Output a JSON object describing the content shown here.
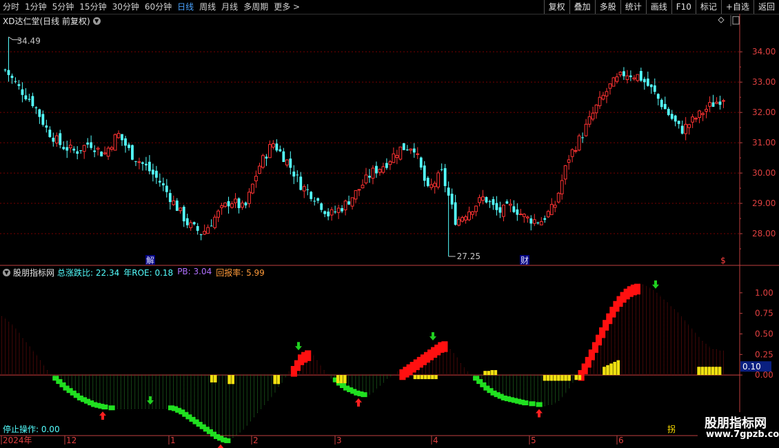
{
  "toolbar": {
    "period_tabs": [
      "分时",
      "1分钟",
      "5分钟",
      "15分钟",
      "30分钟",
      "60分钟",
      "日线",
      "周线",
      "月线",
      "多周期",
      "更多 >"
    ],
    "active_period": "日线",
    "buttons": [
      "复权",
      "叠加",
      "多股",
      "统计",
      "画线",
      "F10",
      "标记",
      "+自选",
      "返回"
    ]
  },
  "main_chart": {
    "title": "XD达仁堂(日线 前复权)",
    "high_label": "34.49",
    "low_label": "27.25",
    "event_marks": [
      "解",
      "财",
      "$"
    ],
    "y_ticks": [
      "34.00",
      "33.00",
      "32.00",
      "31.00",
      "30.00",
      "29.00",
      "28.00"
    ],
    "colors": {
      "up": "#ff3333",
      "down": "#54ffff",
      "grid": "#7a0000",
      "axis": "#c04040"
    }
  },
  "indicator": {
    "name": "股朋指标网",
    "fields": [
      {
        "label": "总涨跌比: 22.34",
        "color": "#54ffff"
      },
      {
        "label": "年ROE: 0.18",
        "color": "#54ffff"
      },
      {
        "label": "PB: 3.04",
        "color": "#b070ff"
      },
      {
        "label": "回报率: 5.99",
        "color": "#ff9a3a"
      }
    ],
    "y_ticks": [
      "1.00",
      "0.75",
      "0.50",
      "0.25",
      "0.00"
    ],
    "current_value": "0.10",
    "status_text": "停止操作: 0.00",
    "corner_label": "拐"
  },
  "chart_data": {
    "type": "candlestick",
    "title": "XD达仁堂(日线 前复权)",
    "x_axis": {
      "labels": [
        "2024年",
        "12",
        "1",
        "2",
        "3",
        "4",
        "5",
        "6"
      ]
    },
    "y_range": [
      27.25,
      34.49
    ],
    "high": 34.49,
    "low": 27.25,
    "price_closes_approx": [
      33.4,
      32.8,
      32.3,
      31.4,
      30.9,
      30.7,
      31.0,
      30.6,
      31.3,
      30.6,
      30.2,
      29.7,
      29.0,
      28.3,
      28.0,
      28.6,
      29.1,
      28.8,
      30.2,
      31.0,
      30.4,
      29.6,
      29.2,
      28.6,
      28.9,
      29.4,
      30.0,
      30.3,
      30.8,
      30.9,
      29.4,
      30.0,
      28.4,
      28.8,
      29.2,
      28.7,
      28.9,
      28.5,
      28.4,
      28.9,
      30.5,
      31.3,
      32.2,
      32.9,
      33.3,
      33.2,
      32.7,
      32.0,
      31.4,
      31.8,
      32.2,
      32.5
    ]
  },
  "indicator_chart": {
    "values": [
      0.72,
      0.69,
      0.65,
      0.61,
      0.56,
      0.51,
      0.45,
      0.4,
      0.35,
      0.29,
      0.24,
      0.18,
      0.12,
      0.06,
      -0.01,
      -0.06,
      -0.1,
      -0.14,
      -0.18,
      -0.21,
      -0.24,
      -0.27,
      -0.3,
      -0.32,
      -0.34,
      -0.36,
      -0.38,
      -0.39,
      -0.4,
      -0.41,
      -0.41,
      -0.42,
      -0.42,
      -0.42,
      -0.42,
      -0.42,
      -0.42,
      -0.42,
      -0.41,
      -0.41,
      -0.41,
      -0.41,
      -0.41,
      -0.41,
      -0.41,
      -0.41,
      -0.41,
      -0.41,
      -0.42,
      -0.43,
      -0.45,
      -0.47,
      -0.5,
      -0.53,
      -0.56,
      -0.59,
      -0.62,
      -0.65,
      -0.68,
      -0.71,
      -0.74,
      -0.77,
      -0.79,
      -0.81,
      -0.82,
      -0.8,
      -0.77,
      -0.74,
      -0.7,
      -0.66,
      -0.62,
      -0.57,
      -0.52,
      -0.47,
      -0.42,
      -0.37,
      -0.32,
      -0.27,
      -0.21,
      -0.15,
      -0.09,
      -0.03,
      0.04,
      0.11,
      0.18,
      0.25,
      0.28,
      0.3,
      0.28,
      0.24,
      0.18,
      0.12,
      0.06,
      0.01,
      -0.04,
      -0.08,
      -0.12,
      -0.15,
      -0.18,
      -0.2,
      -0.22,
      -0.24,
      -0.25,
      -0.26,
      -0.26,
      -0.24,
      -0.21,
      -0.17,
      -0.13,
      -0.09,
      -0.05,
      -0.02,
      0.01,
      0.04,
      0.07,
      0.1,
      0.13,
      0.16,
      0.19,
      0.22,
      0.25,
      0.28,
      0.31,
      0.34,
      0.37,
      0.4,
      0.41,
      0.37,
      0.32,
      0.27,
      0.21,
      0.15,
      0.09,
      0.04,
      -0.01,
      -0.06,
      -0.1,
      -0.14,
      -0.18,
      -0.21,
      -0.24,
      -0.26,
      -0.28,
      -0.3,
      -0.31,
      -0.32,
      -0.33,
      -0.34,
      -0.35,
      -0.36,
      -0.36,
      -0.37,
      -0.37,
      -0.38,
      -0.38,
      -0.38,
      -0.37,
      -0.36,
      -0.34,
      -0.31,
      -0.27,
      -0.22,
      -0.16,
      -0.09,
      -0.02,
      0.06,
      0.14,
      0.22,
      0.31,
      0.4,
      0.49,
      0.58,
      0.67,
      0.75,
      0.83,
      0.9,
      0.96,
      1.01,
      1.05,
      1.08,
      1.1,
      1.11,
      1.11,
      1.1,
      1.08,
      1.06,
      1.03,
      1.0,
      0.96,
      0.92,
      0.88,
      0.84,
      0.8,
      0.76,
      0.71,
      0.66,
      0.61,
      0.56,
      0.51,
      0.46,
      0.42,
      0.38,
      0.34,
      0.32,
      0.31,
      0.3,
      0.3
    ],
    "yellow_bars": [
      {
        "index": 60,
        "value": -0.09
      },
      {
        "index": 61,
        "value": -0.09
      },
      {
        "index": 65,
        "value": -0.11
      },
      {
        "index": 66,
        "value": -0.11
      },
      {
        "index": 78,
        "value": -0.11
      },
      {
        "index": 79,
        "value": -0.11
      },
      {
        "index": 96,
        "value": -0.1
      },
      {
        "index": 97,
        "value": -0.1
      },
      {
        "index": 98,
        "value": -0.1
      },
      {
        "index": 118,
        "value": -0.05
      },
      {
        "index": 119,
        "value": -0.05
      },
      {
        "index": 120,
        "value": -0.05
      },
      {
        "index": 121,
        "value": -0.05
      },
      {
        "index": 122,
        "value": -0.05
      },
      {
        "index": 123,
        "value": -0.05
      },
      {
        "index": 124,
        "value": -0.05
      },
      {
        "index": 138,
        "value": 0.05
      },
      {
        "index": 139,
        "value": 0.05
      },
      {
        "index": 140,
        "value": 0.06
      },
      {
        "index": 141,
        "value": 0.06
      },
      {
        "index": 155,
        "value": -0.07
      },
      {
        "index": 156,
        "value": -0.07
      },
      {
        "index": 157,
        "value": -0.07
      },
      {
        "index": 158,
        "value": -0.07
      },
      {
        "index": 159,
        "value": -0.07
      },
      {
        "index": 160,
        "value": -0.07
      },
      {
        "index": 161,
        "value": -0.07
      },
      {
        "index": 162,
        "value": -0.07
      },
      {
        "index": 164,
        "value": -0.06
      },
      {
        "index": 165,
        "value": -0.06
      },
      {
        "index": 172,
        "value": 0.1
      },
      {
        "index": 173,
        "value": 0.12
      },
      {
        "index": 174,
        "value": 0.14
      },
      {
        "index": 175,
        "value": 0.16
      },
      {
        "index": 176,
        "value": 0.18
      },
      {
        "index": 199,
        "value": 0.1
      },
      {
        "index": 200,
        "value": 0.1
      },
      {
        "index": 201,
        "value": 0.1
      },
      {
        "index": 202,
        "value": 0.1
      },
      {
        "index": 203,
        "value": 0.1
      },
      {
        "index": 204,
        "value": 0.1
      },
      {
        "index": 205,
        "value": 0.1
      }
    ]
  },
  "brand": {
    "name": "股朋指标网",
    "url": "www.7gpzb.com"
  }
}
